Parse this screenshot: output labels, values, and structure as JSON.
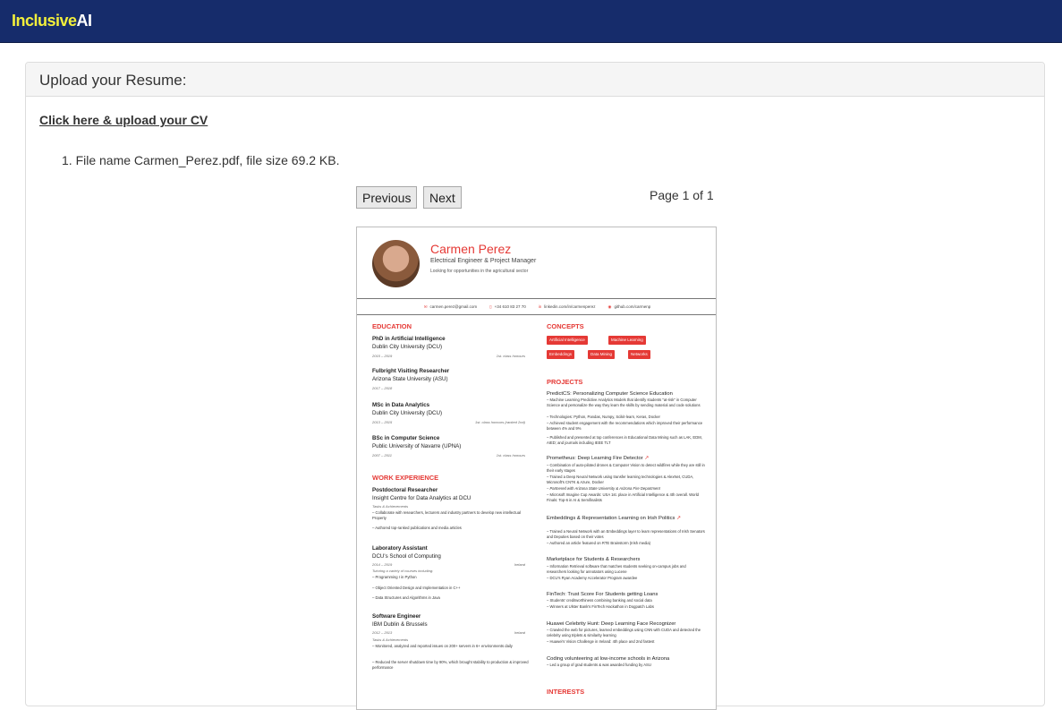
{
  "navbar": {
    "brand_part1": "Inclusive",
    "brand_part2": "AI"
  },
  "panel": {
    "heading": "Upload your Resume:",
    "upload_link": "Click here & upload your CV"
  },
  "files": [
    "1. File name Carmen_Perez.pdf, file size 69.2 KB."
  ],
  "pager": {
    "previous": "Previous",
    "next": "Next",
    "page_info": "Page 1 of 1"
  },
  "resume": {
    "name": "Carmen Perez",
    "title": "Electrical Engineer & Project Manager",
    "tagline": "Looking for opportunities in the agricultural sector",
    "contacts": [
      "carmen.perez@gmail.com",
      "+34 610 83 27 70",
      "linkedin.com/in/carmenperez",
      "github.com/carmenp"
    ],
    "education_heading": "EDUCATION",
    "education": [
      {
        "degree": "PhD in Artificial Intelligence",
        "school": "Dublin City University (DCU)",
        "dates": "2015 – 2019",
        "note": "1st. class honours"
      },
      {
        "degree": "Fulbright Visiting Researcher",
        "school": "Arizona State University (ASU)",
        "dates": "2017 – 2018",
        "note": ""
      },
      {
        "degree": "MSc in Data Analytics",
        "school": "Dublin City University (DCU)",
        "dates": "2013 – 2015",
        "note": "1st. class honours (ranked 2nd)"
      },
      {
        "degree": "BSc in Computer Science",
        "school": "Public University of Navarre (UPNA)",
        "dates": "2007 – 2011",
        "note": "1st. class honours"
      }
    ],
    "work_heading": "WORK EXPERIENCE",
    "work": [
      {
        "role": "Postdoctoral Researcher",
        "org": "Insight Centre for Data Analytics at DCU",
        "sub": "Tasks & Achievements",
        "loc": "",
        "bullets": [
          "Collaborate with researchers, lecturers and industry partners to develop new intellectual Property",
          "Authored top-ranked publications and media articles"
        ]
      },
      {
        "role": "Laboratory Assistant",
        "org": "DCU's School of Computing",
        "sub": "2014 – 2019",
        "loc": "Ireland",
        "bullets": [
          "Tutoring a variety of courses including:",
          "Programming I in Python",
          "Object Oriented Design and Implementation in C++",
          "Data Structures and Algorithms in Java"
        ]
      },
      {
        "role": "Software Engineer",
        "org": "IBM Dublin & Brussels",
        "sub": "2012 – 2013",
        "loc": "Ireland",
        "bullets": [
          "Tasks & Achievements",
          "Monitored, analyzed and reported issues on 200+ servers in 6+ environments daily",
          "Reduced the server shutdown time by 90%, which brought stability to production & improved performance"
        ]
      }
    ],
    "concepts_heading": "CONCEPTS",
    "concepts": [
      "Artificial Intelligence",
      "Machine Learning",
      "Embeddings",
      "Data Mining",
      "Networks"
    ],
    "projects_heading": "PROJECTS",
    "projects": [
      {
        "title": "PredictCS: Personalizing Computer Science Education",
        "bullets": [
          "Machine Learning Predictive Analytics Models that identify students \"at-risk\" in Computer Science and personalize the way they learn the skills by sending material and code solutions",
          "Technologies: Python, Pandas, Numpy, Scikit-learn, Keras, Docker",
          "Achieved student engagement with the recommendations which improved their performance between 4% and 9%",
          "Published and presented at top conferences in Educational Data Mining such as LAK, EDM, AIED; and journals including IEEE TLT"
        ]
      },
      {
        "title": "Prometheus: Deep Learning Fire Detector",
        "bullets": [
          "Combination of auto-piloted drones & Computer Vision to detect wildfires while they are still in their early stages",
          "Trained a Deep Neural Network using transfer learning technologies & AlexNet, CUDA, Microsoft's CNTK & Azure, Docker",
          "Partnered with Arizona State University & Arizona Fire Department",
          "Microsoft Imagine Cup Awards: USA 1st. place in Artificial Intelligence & 4th overall. World Finals: Top-6 in AI & Semifinalists"
        ]
      },
      {
        "title": "Embeddings & Representation Learning on Irish Politics",
        "bullets": [
          "Trained a Neural Network with an Embeddings layer to learn representations of Irish Senators and Deputies based on their votes",
          "Authored an article featured on RTE Brainstorm (Irish media)"
        ]
      },
      {
        "title": "Marketplace for Students & Researchers",
        "bullets": [
          "Information Retrieval software that matches students seeking on-campus jobs and researchers looking for annotators using Lucene",
          "DCU's Ryan Academy Accelerator Program awardee"
        ]
      },
      {
        "title": "FinTech: Trust Score For Students getting Loans",
        "bullets": [
          "Students' creditworthiness combining banking and social data",
          "Winners at Ulster Bank's FinTech Hackathon in Dogpatch Labs"
        ]
      },
      {
        "title": "Huawei Celebrity Hunt: Deep Learning Face Recognizer",
        "bullets": [
          "Crawled the web for pictures, learned embeddings using CNN with CUDA and detected the celebrity using triplets & similarity learning",
          "Huawei's Vision Challenge in Ireland: 4th place and 2nd fastest"
        ]
      },
      {
        "title": "Coding volunteering at low-income schools in Arizona",
        "bullets": [
          "Led a group of grad students & was awarded funding by ASU"
        ]
      }
    ],
    "interests_heading": "INTERESTS"
  },
  "colors": {
    "navbar": "#162c6b",
    "brand_yellow": "#f2ef3b",
    "resume_accent": "#e53935"
  }
}
